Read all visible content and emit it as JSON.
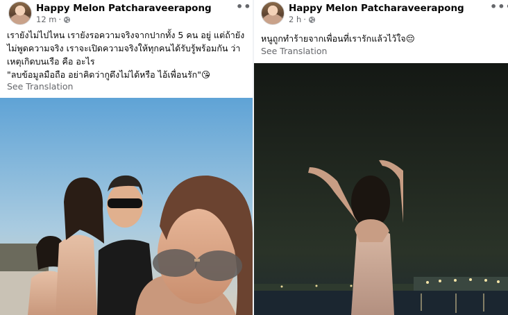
{
  "posts": [
    {
      "author": "Happy Melon Patcharaveerapong",
      "time": "12 m",
      "text_lines": [
        "เรายังไม่ไปไหน  เรายังรอความจริงจากปากทั้ง 5 คน อยู่ แต่ถ้ายัง",
        "ไม่พูดความจริง เราจะเปิดความจริงให้ทุกคนได้รับรู้พร้อมกัน  ว่า",
        "เหตุเกิดบนเรือ  คือ อะไร",
        "\"ลบข้อมูลมือถือ อย่าคิดว่ากูดึงไม่ได้หรือ ไอ้เพื่อนรัก\"😘"
      ],
      "see_translation": "See Translation",
      "more": "•••"
    },
    {
      "author": "Happy Melon Patcharaveerapong",
      "time": "2 h",
      "text_lines": [
        "หนูถูกทำร้ายจากเพื่อนที่เรารักแล้วไว้ใจ😔"
      ],
      "see_translation": "See Translation",
      "more": "•••"
    }
  ],
  "icons": {
    "privacy": "globe-icon",
    "menu": "more-options-icon"
  },
  "colors": {
    "text": "#050505",
    "secondary": "#65676b",
    "divider": "#f0f2f5"
  }
}
